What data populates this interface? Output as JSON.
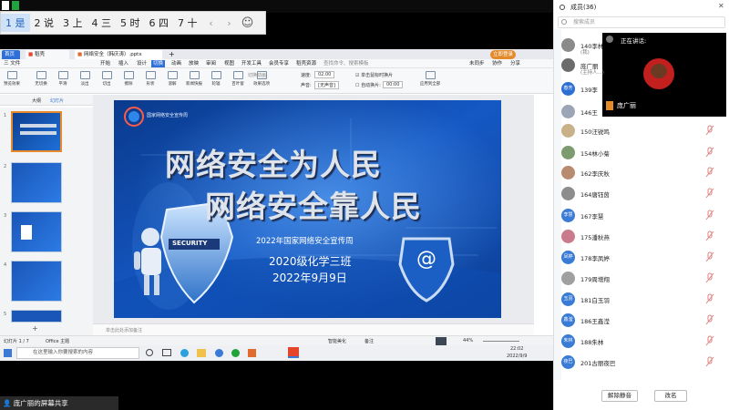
{
  "ime": {
    "candidates": [
      "1 是",
      "2 说",
      "3 上",
      "4 三",
      "5 时",
      "6 四",
      "7 十"
    ],
    "prev": "‹",
    "next": "›",
    "emoji": "☺"
  },
  "ppt": {
    "tabs": [
      "首页",
      "稻壳",
      "网络安全（韩庆涛）.pptx"
    ],
    "login_badge": "立即登录",
    "menu": [
      "三 文件",
      "开始",
      "插入",
      "设计",
      "切换",
      "动画",
      "放映",
      "审阅",
      "视图",
      "开发工具",
      "会员专享",
      "稻壳资源",
      "查找命令、搜索模板",
      "未同步",
      "协作",
      "分享"
    ],
    "ribbon_buttons": [
      "预览效果",
      "无切换",
      "平滑",
      "淡出",
      "切出",
      "擦除",
      "形状",
      "溶解",
      "新闻快报",
      "轮辐",
      "百叶窗",
      "效果选项"
    ],
    "ribbon": {
      "sound_label": "声音:",
      "sound_value": "[无声音]",
      "speed_label": "速度:",
      "speed_value": "02.00",
      "mouse_switch": "单击鼠标时换片",
      "auto_switch": "自动换片:",
      "auto_time": "00:00",
      "apply_all": "应用到全部",
      "anim_label": "切换动画"
    },
    "panel_tabs": [
      "大纲",
      "幻灯片"
    ],
    "thumb_numbers": [
      "1",
      "2",
      "3",
      "4",
      "5"
    ],
    "notes_placeholder": "单击此处添加备注",
    "status": {
      "slide_count": "幻灯片 1 / 7",
      "theme": "Office 主题",
      "smart_beautify": "智能美化",
      "notes": "备注",
      "zoom": "44%"
    }
  },
  "slide": {
    "title_line1": "网络安全为人民",
    "title_line2": "网络安全靠人民",
    "subtitle": "2022年国家网络安全宣传周",
    "class": "2020级化学三班",
    "date": "2022年9月9日",
    "logo_text": "国家网络安全宣传周",
    "shield_text": "SECURITY",
    "email_symbol": "@"
  },
  "taskbar": {
    "search_placeholder": "在这里输入你要搜索的内容",
    "time": "22:02",
    "date": "2022/9/9"
  },
  "share_label": "庞广丽的屏幕共享",
  "members": {
    "title": "成员(36)",
    "search_placeholder": "搜索成员",
    "speaking_label": "正在讲话:",
    "speaker_name": "庞广丽",
    "list": [
      {
        "name": "140李林",
        "sub": "(我)",
        "avatar": "",
        "color": "#8a8a8a"
      },
      {
        "name": "庞广丽",
        "sub": "(主持人...)",
        "avatar": "",
        "color": "#6b6b6b"
      },
      {
        "name": "139李",
        "sub": "",
        "avatar": "春芳",
        "color": "#2e6fd3"
      },
      {
        "name": "146王",
        "sub": "",
        "avatar": "",
        "color": "#9aa6b5"
      },
      {
        "name": "150汪锐鸣",
        "sub": "",
        "avatar": "",
        "color": "#c9b18a"
      },
      {
        "name": "154林小菊",
        "sub": "",
        "avatar": "",
        "color": "#7c9b6f"
      },
      {
        "name": "162李庆秋",
        "sub": "",
        "avatar": "",
        "color": "#b88a70"
      },
      {
        "name": "164唐钰茵",
        "sub": "",
        "avatar": "",
        "color": "#8d8d8d"
      },
      {
        "name": "167李慧",
        "sub": "",
        "avatar": "李慧",
        "color": "#3a7bd5"
      },
      {
        "name": "175潘秋燕",
        "sub": "",
        "avatar": "",
        "color": "#c97b8c"
      },
      {
        "name": "178李凤婷",
        "sub": "",
        "avatar": "凤婷",
        "color": "#3a7bd5"
      },
      {
        "name": "179周增翔",
        "sub": "",
        "avatar": "",
        "color": "#a0a0a0"
      },
      {
        "name": "181白玉羽",
        "sub": "",
        "avatar": "玉羽",
        "color": "#3a7bd5"
      },
      {
        "name": "186王鑫滢",
        "sub": "",
        "avatar": "鑫滢",
        "color": "#3a7bd5"
      },
      {
        "name": "188朱林",
        "sub": "",
        "avatar": "朱林",
        "color": "#3a7bd5"
      },
      {
        "name": "201古丽夜巴",
        "sub": "",
        "avatar": "夜巴",
        "color": "#3a7bd5"
      }
    ],
    "unmute_all": "解除静音",
    "rename": "改名"
  }
}
